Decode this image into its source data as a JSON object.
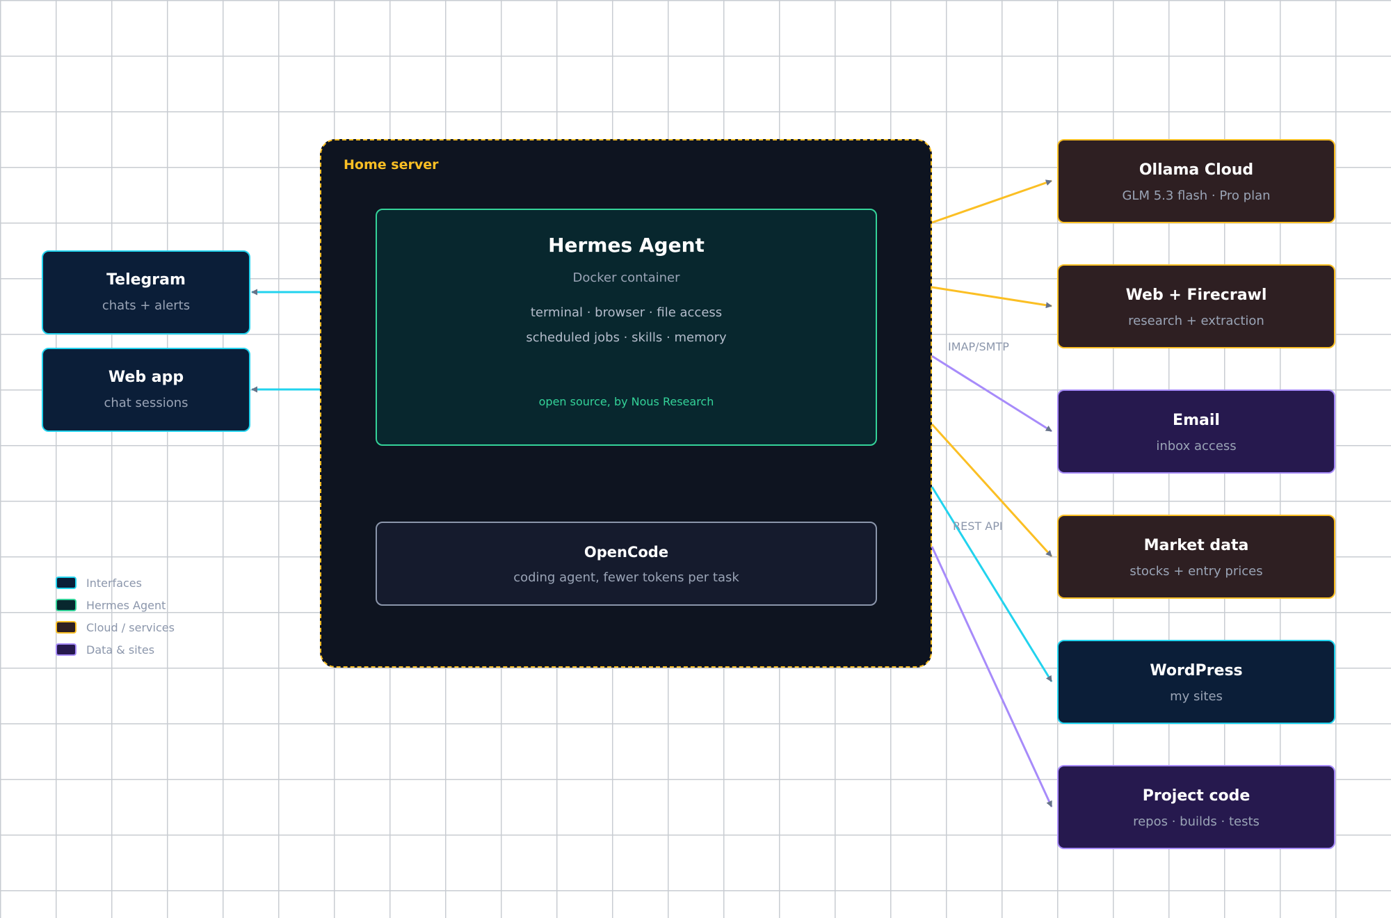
{
  "server": {
    "label": "Home server"
  },
  "hermes": {
    "title": "Hermes Agent",
    "subtitle": "Docker container",
    "capabilities_line1": "terminal · browser · file access",
    "capabilities_line2": "scheduled jobs · skills · memory",
    "credit": "open source, by Nous Research"
  },
  "opencode": {
    "title": "OpenCode",
    "subtitle": "coding agent, fewer tokens per task"
  },
  "interfaces": [
    {
      "title": "Telegram",
      "subtitle": "chats + alerts"
    },
    {
      "title": "Web app",
      "subtitle": "chat sessions"
    }
  ],
  "services": [
    {
      "title": "Ollama Cloud",
      "subtitle": "GLM 5.3 flash · Pro plan",
      "kind": "cloud"
    },
    {
      "title": "Web + Firecrawl",
      "subtitle": "research + extraction",
      "kind": "cloud"
    },
    {
      "title": "Email",
      "subtitle": "inbox access",
      "kind": "data"
    },
    {
      "title": "Market data",
      "subtitle": "stocks + entry prices",
      "kind": "cloud"
    },
    {
      "title": "WordPress",
      "subtitle": "my sites",
      "kind": "interface"
    },
    {
      "title": "Project code",
      "subtitle": "repos · builds · tests",
      "kind": "data"
    }
  ],
  "edge_labels": {
    "email": "IMAP/SMTP",
    "wordpress": "REST API"
  },
  "legend": [
    {
      "label": "Interfaces",
      "fill": "#0b1e38",
      "stroke": "#22d3ee"
    },
    {
      "label": "Hermes Agent",
      "fill": "#08272e",
      "stroke": "#34d399"
    },
    {
      "label": "Cloud / services",
      "fill": "#2e1f22",
      "stroke": "#fbbf24"
    },
    {
      "label": "Data & sites",
      "fill": "#26194e",
      "stroke": "#a78bfa"
    }
  ],
  "colors": {
    "interface": "#22d3ee",
    "agent": "#34d399",
    "cloud": "#fbbf24",
    "data": "#a78bfa",
    "arrowhead": "#667389",
    "server_border": "#fbbf24"
  }
}
